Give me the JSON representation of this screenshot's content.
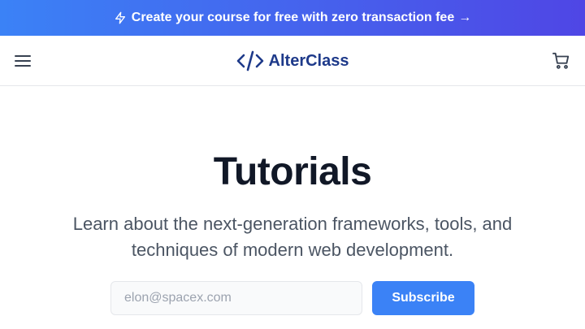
{
  "promo": {
    "icon": "lightning-bolt-icon",
    "text": "Create your course for free with zero transaction fee",
    "arrow": "→"
  },
  "navbar": {
    "menu_icon": "hamburger-menu-icon",
    "logo_icon": "code-brackets-icon",
    "brand": "AlterClass",
    "cart_icon": "shopping-cart-icon"
  },
  "hero": {
    "title": "Tutorials",
    "subtitle": "Learn about the next-generation frameworks, tools, and techniques of modern web development."
  },
  "subscribe_form": {
    "email_placeholder": "elon@spacex.com",
    "email_value": "",
    "button_label": "Subscribe"
  },
  "colors": {
    "promo_gradient_start": "#3b82f6",
    "promo_gradient_end": "#4f46e5",
    "brand": "#1e3a8a",
    "accent": "#3b82f6",
    "title": "#111827",
    "subtitle": "#4b5563"
  }
}
